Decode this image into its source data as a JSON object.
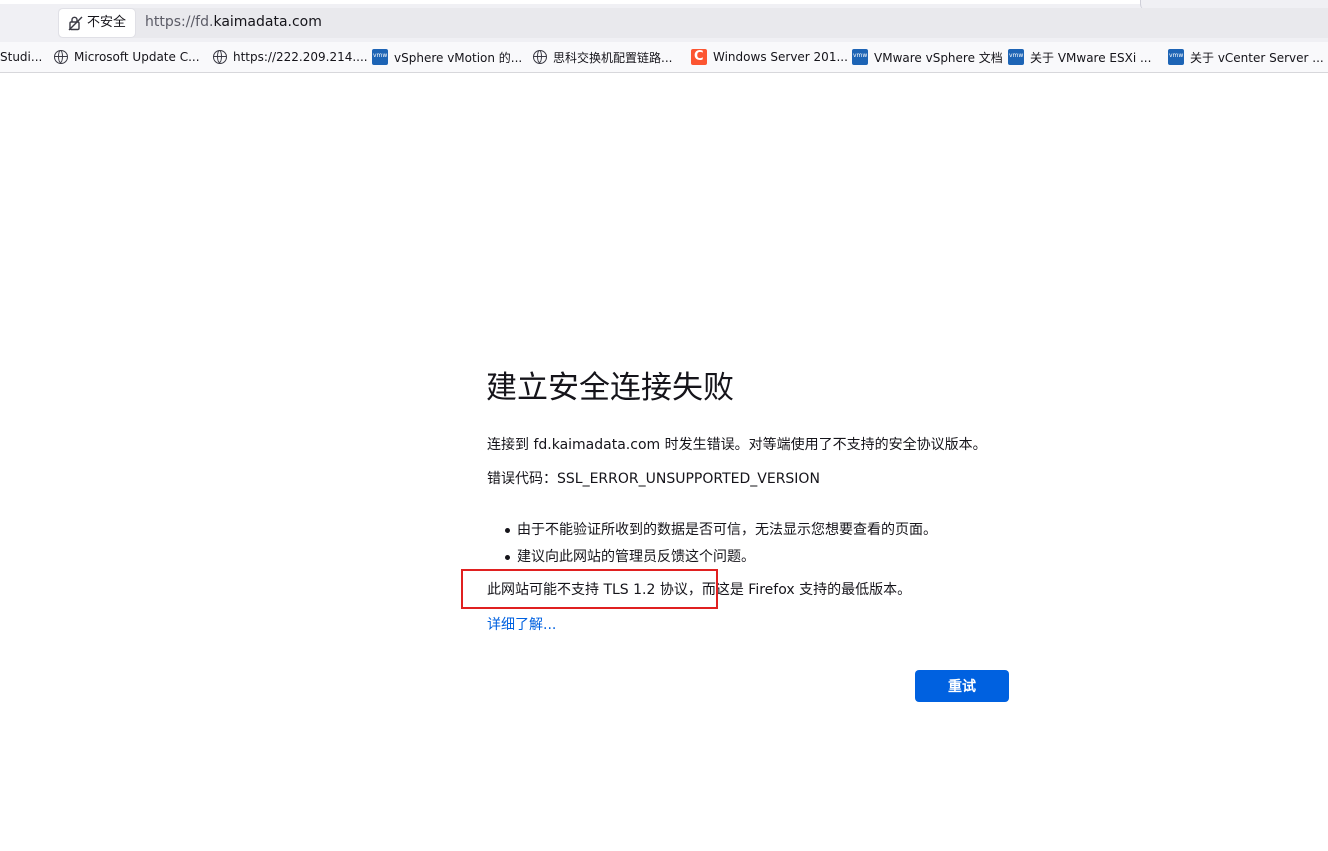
{
  "urlbar": {
    "security_label": "不安全",
    "url_prefix": "https://fd.",
    "url_domain": "kaimadata.com"
  },
  "bookmarks": [
    {
      "label": "Studi...",
      "icon": "none"
    },
    {
      "label": "Microsoft Update C...",
      "icon": "globe-icon"
    },
    {
      "label": "https://222.209.214....",
      "icon": "globe-icon"
    },
    {
      "label": "vSphere vMotion 的...",
      "icon": "vmware-icon"
    },
    {
      "label": "思科交换机配置链路...",
      "icon": "globe-icon"
    },
    {
      "label": "Windows Server 201...",
      "icon": "csdn-icon"
    },
    {
      "label": "VMware vSphere 文档",
      "icon": "vmware-icon"
    },
    {
      "label": "关于 VMware ESXi ...",
      "icon": "vmware-icon"
    },
    {
      "label": "关于 vCenter Server ...",
      "icon": "vmware-icon"
    }
  ],
  "error_page": {
    "title": "建立安全连接失败",
    "description": "连接到 fd.kaimadata.com 时发生错误。对等端使用了不支持的安全协议版本。",
    "error_code": "错误代码：SSL_ERROR_UNSUPPORTED_VERSION",
    "bullets": [
      "由于不能验证所收到的数据是否可信，无法显示您想要查看的页面。",
      "建议向此网站的管理员反馈这个问题。"
    ],
    "tls_note": "此网站可能不支持 TLS 1.2 协议，而这是 Firefox 支持的最低版本。",
    "learn_more": "详细了解...",
    "retry_button": "重试"
  },
  "colors": {
    "accent": "#0061e0",
    "annotation": "#e02020"
  }
}
